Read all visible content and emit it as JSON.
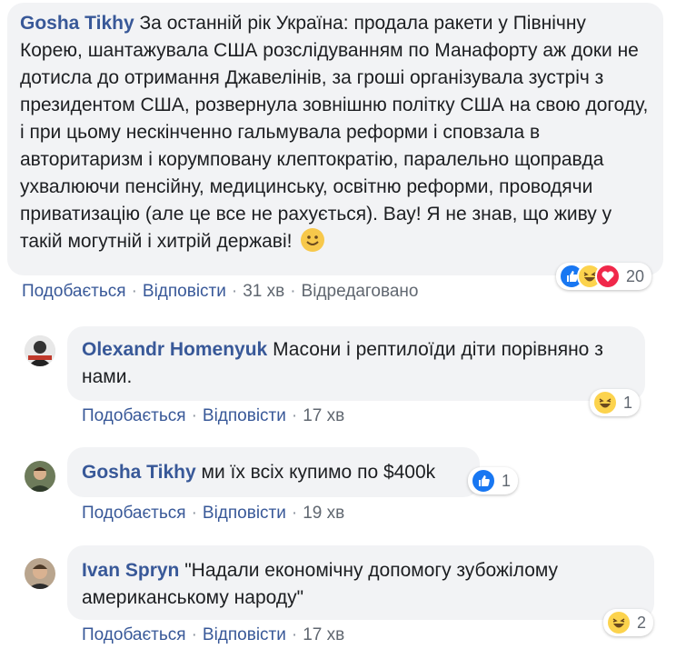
{
  "comments": [
    {
      "author": "Gosha Tikhy",
      "text": "За останній рік Україна: продала ракети у Північну Корею, шантажувала США розслідуванням по Манафорту аж доки не дотисла до отримання Джавелінів, за гроші організувала зустріч з президентом США, розвернула зовнішню політку США на свою догоду, і при цьому нескінченно гальмувала реформи і сповзала в авторитаризм і корумповану клептократію, паралельно щоправда ухвалюючи пенсійну, медицинську, освітню реформи, проводячи приватизацію (але це все не рахується). Вау! Я не знав, що живу у такій могутній і хитрій державі!",
      "like_label": "Подобається",
      "reply_label": "Відповісти",
      "time": "31 хв",
      "edited": "Відредаговано",
      "reaction_count": "20",
      "reaction_icons": [
        "like-icon",
        "laugh-icon",
        "love-icon"
      ]
    },
    {
      "author": "Olexandr Homenyuk",
      "text": "Масони і рептилоїди діти порівняно з нами.",
      "like_label": "Подобається",
      "reply_label": "Відповісти",
      "time": "17 хв",
      "reaction_count": "1",
      "reaction_icons": [
        "laugh-icon"
      ]
    },
    {
      "author": "Gosha Tikhy",
      "text": "ми їх всіх купимо по $400k",
      "like_label": "Подобається",
      "reply_label": "Відповісти",
      "time": "19 хв",
      "reaction_count": "1",
      "reaction_icons": [
        "like-icon"
      ]
    },
    {
      "author": "Ivan Spryn",
      "text": "\"Надали економічну допомогу зубожілому американському народу\"",
      "like_label": "Подобається",
      "reply_label": "Відповісти",
      "time": "17 хв",
      "reaction_count": "2",
      "reaction_icons": [
        "laugh-icon"
      ]
    }
  ],
  "colors": {
    "author": "#385898",
    "bubble": "#f2f3f5",
    "meta": "#606770",
    "like": "#1877f2",
    "laugh": "#fcd34d",
    "love": "#f0284a"
  }
}
